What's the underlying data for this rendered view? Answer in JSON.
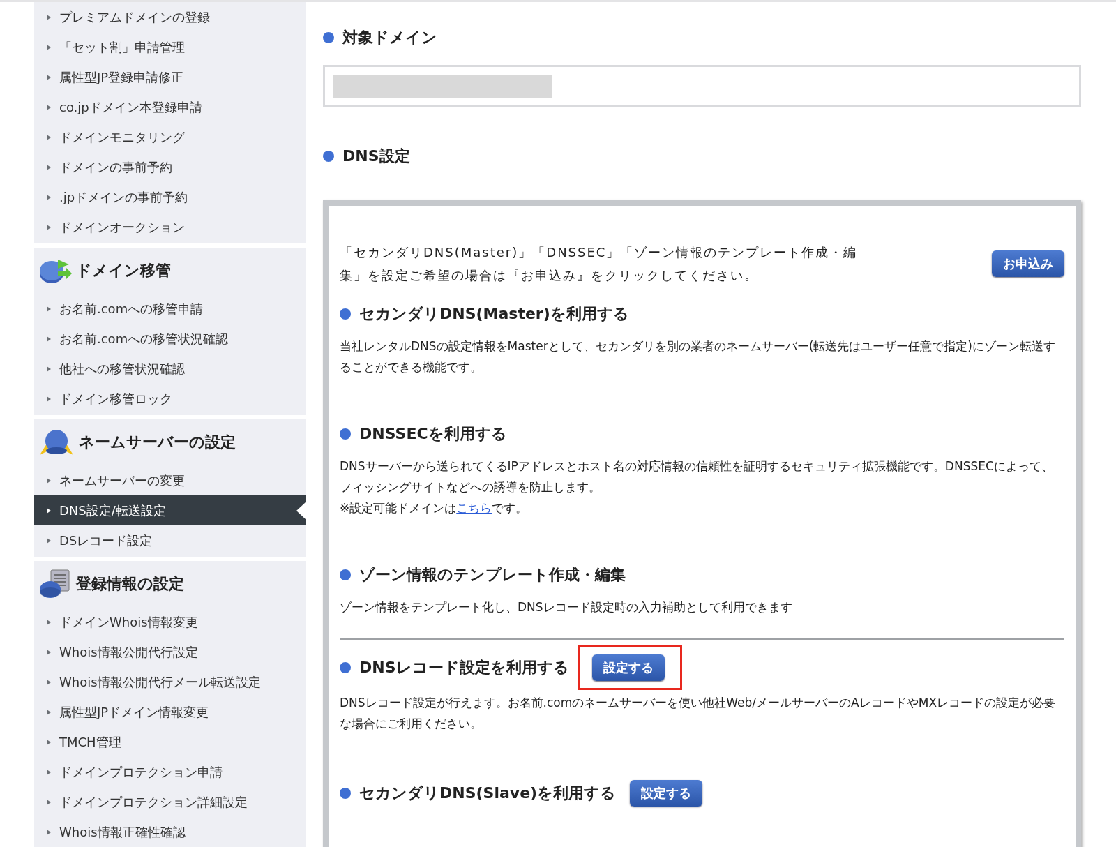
{
  "sidebar": {
    "groups": [
      {
        "items": [
          {
            "label": "プレミアムドメインの登録",
            "selected": false
          },
          {
            "label": "「セット割」申請管理",
            "selected": false
          },
          {
            "label": "属性型JP登録申請修正",
            "selected": false
          },
          {
            "label": "co.jpドメイン本登録申請",
            "selected": false
          },
          {
            "label": "ドメインモニタリング",
            "selected": false
          },
          {
            "label": "ドメインの事前予約",
            "selected": false
          },
          {
            "label": ".jpドメインの事前予約",
            "selected": false
          },
          {
            "label": "ドメインオークション",
            "selected": false
          }
        ]
      },
      {
        "title": "ドメイン移管",
        "kind": "transfer",
        "items": [
          {
            "label": "お名前.comへの移管申請",
            "selected": false
          },
          {
            "label": "お名前.comへの移管状況確認",
            "selected": false
          },
          {
            "label": "他社への移管状況確認",
            "selected": false
          },
          {
            "label": "ドメイン移管ロック",
            "selected": false
          }
        ]
      },
      {
        "title": "ネームサーバーの設定",
        "kind": "nameserver",
        "items": [
          {
            "label": "ネームサーバーの変更",
            "selected": false
          },
          {
            "label": "DNS設定/転送設定",
            "selected": true
          },
          {
            "label": "DSレコード設定",
            "selected": false
          }
        ]
      },
      {
        "title": "登録情報の設定",
        "kind": "registration",
        "items": [
          {
            "label": "ドメインWhois情報変更",
            "selected": false
          },
          {
            "label": "Whois情報公開代行設定",
            "selected": false
          },
          {
            "label": "Whois情報公開代行メール転送設定",
            "selected": false
          },
          {
            "label": "属性型JPドメイン情報変更",
            "selected": false
          },
          {
            "label": "TMCH管理",
            "selected": false
          },
          {
            "label": "ドメインプロテクション申請",
            "selected": false
          },
          {
            "label": "ドメインプロテクション詳細設定",
            "selected": false
          },
          {
            "label": "Whois情報正確性確認",
            "selected": false
          }
        ]
      }
    ]
  },
  "target_domain": {
    "heading": "対象ドメイン"
  },
  "dns_settings": {
    "heading": "DNS設定",
    "intro": "「セカンダリDNS(Master)」「DNSSEC」「ゾーン情報のテンプレート作成・編集」を設定ご希望の場合は『お申込み』をクリックしてください。",
    "apply_button": "お申込み",
    "sections": [
      {
        "title": "セカンダリDNS(Master)を利用する",
        "divider_before": false,
        "paragraphs": [
          {
            "text": "当社レンタルDNSの設定情報をMasterとして、セカンダリを別の業者のネームサーバー(転送先はユーザー任意で指定)にゾーン転送することができる機能です。"
          }
        ]
      },
      {
        "title": "DNSSECを利用する",
        "divider_before": false,
        "paragraphs": [
          {
            "text": "DNSサーバーから送られてくるIPアドレスとホスト名の対応情報の信頼性を証明するセキュリティ拡張機能です。DNSSECによって、フィッシングサイトなどへの誘導を防止します。"
          },
          {
            "text": "※設定可能ドメインは",
            "link": "こちら",
            "after": "です。"
          }
        ]
      },
      {
        "title": "ゾーン情報のテンプレート作成・編集",
        "divider_before": false,
        "paragraphs": [
          {
            "text": "ゾーン情報をテンプレート化し、DNSレコード設定時の入力補助として利用できます"
          }
        ]
      },
      {
        "title": "DNSレコード設定を利用する",
        "divider_before": true,
        "button": "設定する",
        "highlighted": true,
        "paragraphs": [
          {
            "text": "DNSレコード設定が行えます。お名前.comのネームサーバーを使い他社Web/メールサーバーのAレコードやMXレコードの設定が必要な場合にご利用ください。"
          }
        ]
      },
      {
        "title": "セカンダリDNS(Slave)を利用する",
        "divider_before": false,
        "button": "設定する",
        "highlighted": false
      }
    ]
  }
}
